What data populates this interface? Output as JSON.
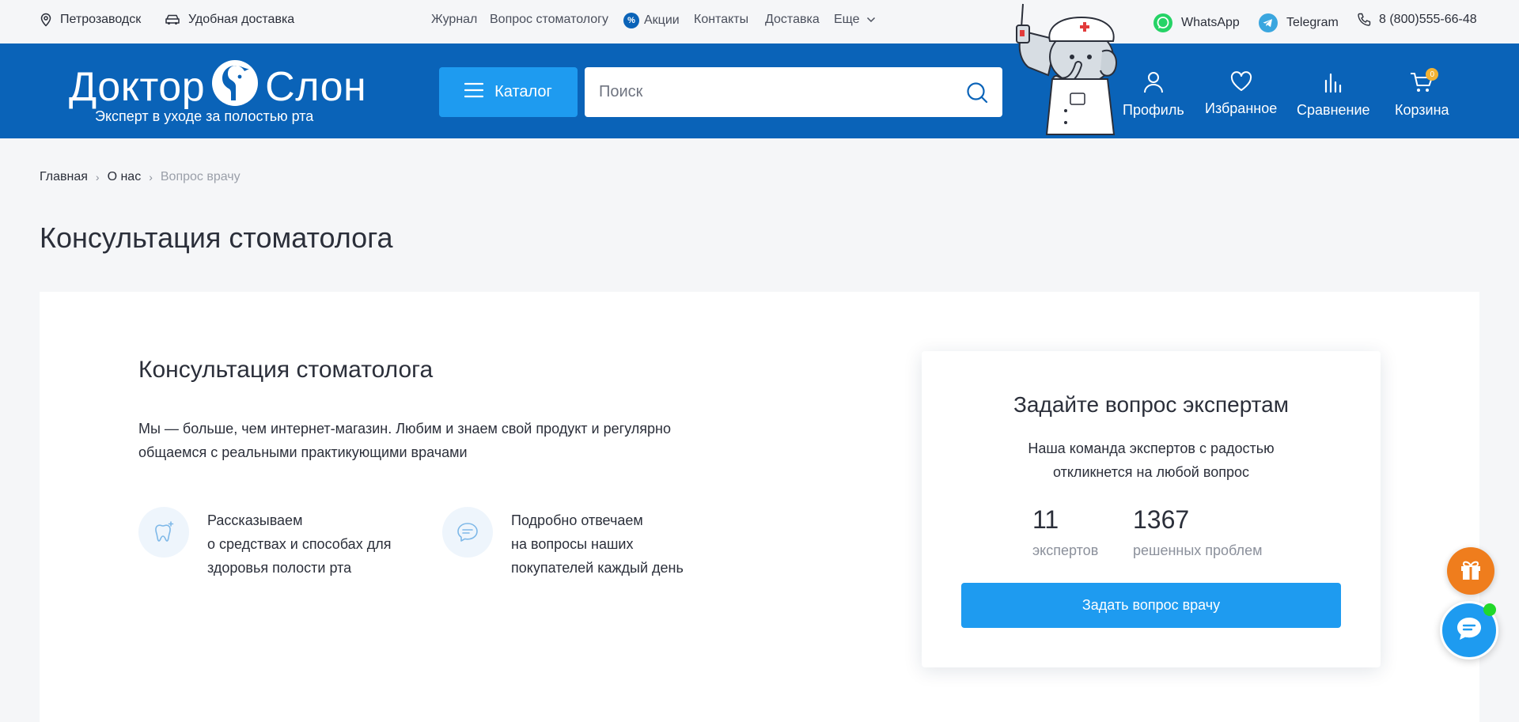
{
  "topbar": {
    "city": "Петрозаводск",
    "delivery": "Удобная доставка",
    "nav": [
      "Журнал",
      "Вопрос стоматологу",
      "Акции",
      "Контакты",
      "Доставка",
      "Еще"
    ],
    "promo_badge": "%",
    "whatsapp": "WhatsApp",
    "telegram": "Telegram",
    "phone": "8 (800)555-66-48"
  },
  "header": {
    "logo_word1": "Доктор",
    "logo_word2": "Слон",
    "logo_tagline": "Эксперт в уходе за полостью рта",
    "catalog_label": "Каталог",
    "search_placeholder": "Поиск",
    "actions": {
      "profile": "Профиль",
      "favorites": "Избранное",
      "compare": "Сравнение",
      "cart": "Корзина"
    },
    "cart_count": "0"
  },
  "breadcrumb": [
    "Главная",
    "О нас",
    "Вопрос врачу"
  ],
  "page_title": "Консультация стоматолога",
  "content": {
    "title": "Консультация стоматолога",
    "lead": "Мы — больше, чем интернет-магазин. Любим и знаем свой продукт и регулярно общаемся с реальными практикующими врачами",
    "features": [
      {
        "title": "Рассказываем",
        "text": "о средствах и способах для здоровья полости рта",
        "icon": "tooth-icon"
      },
      {
        "title": "Подробно отвечаем",
        "text": "на вопросы наших покупателей каждый день",
        "icon": "chat-icon"
      }
    ]
  },
  "ask_card": {
    "title": "Задайте вопрос экспертам",
    "subtitle": "Наша команда экспертов с радостью откликнется на любой вопрос",
    "stats": [
      {
        "value": "11",
        "label": "экспертов"
      },
      {
        "value": "1367",
        "label": "решенных проблем"
      }
    ],
    "button": "Задать вопрос врачу"
  },
  "colors": {
    "brand_blue": "#0a63b8",
    "accent_blue": "#1e9bf0",
    "gift_orange": "#ef7d1d",
    "online_green": "#21d82a"
  }
}
